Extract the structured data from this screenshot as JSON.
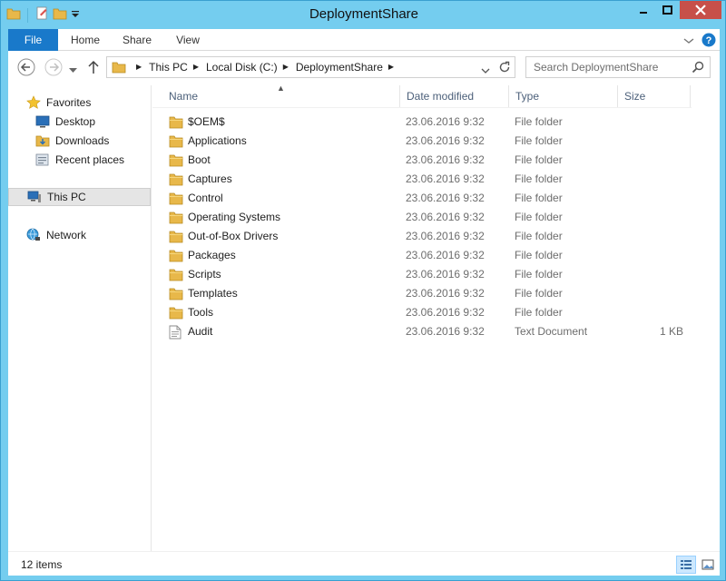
{
  "window": {
    "title": "DeploymentShare"
  },
  "ribbon": {
    "tabs": [
      {
        "label": "File"
      },
      {
        "label": "Home"
      },
      {
        "label": "Share"
      },
      {
        "label": "View"
      }
    ]
  },
  "address": {
    "crumbs": [
      "This PC",
      "Local Disk (C:)",
      "DeploymentShare"
    ]
  },
  "search": {
    "placeholder": "Search DeploymentShare"
  },
  "nav": {
    "favorites": "Favorites",
    "desktop": "Desktop",
    "downloads": "Downloads",
    "recent": "Recent places",
    "thispc": "This PC",
    "network": "Network"
  },
  "columns": {
    "name": "Name",
    "date": "Date modified",
    "type": "Type",
    "size": "Size"
  },
  "files": [
    {
      "name": "$OEM$",
      "date": "23.06.2016 9:32",
      "type": "File folder",
      "size": "",
      "icon": "folder-icon"
    },
    {
      "name": "Applications",
      "date": "23.06.2016 9:32",
      "type": "File folder",
      "size": "",
      "icon": "folder-icon"
    },
    {
      "name": "Boot",
      "date": "23.06.2016 9:32",
      "type": "File folder",
      "size": "",
      "icon": "folder-icon"
    },
    {
      "name": "Captures",
      "date": "23.06.2016 9:32",
      "type": "File folder",
      "size": "",
      "icon": "folder-icon"
    },
    {
      "name": "Control",
      "date": "23.06.2016 9:32",
      "type": "File folder",
      "size": "",
      "icon": "folder-icon"
    },
    {
      "name": "Operating Systems",
      "date": "23.06.2016 9:32",
      "type": "File folder",
      "size": "",
      "icon": "folder-icon"
    },
    {
      "name": "Out-of-Box Drivers",
      "date": "23.06.2016 9:32",
      "type": "File folder",
      "size": "",
      "icon": "folder-icon"
    },
    {
      "name": "Packages",
      "date": "23.06.2016 9:32",
      "type": "File folder",
      "size": "",
      "icon": "folder-icon"
    },
    {
      "name": "Scripts",
      "date": "23.06.2016 9:32",
      "type": "File folder",
      "size": "",
      "icon": "folder-icon"
    },
    {
      "name": "Templates",
      "date": "23.06.2016 9:32",
      "type": "File folder",
      "size": "",
      "icon": "folder-icon"
    },
    {
      "name": "Tools",
      "date": "23.06.2016 9:32",
      "type": "File folder",
      "size": "",
      "icon": "folder-icon"
    },
    {
      "name": "Audit",
      "date": "23.06.2016 9:32",
      "type": "Text Document",
      "size": "1 KB",
      "icon": "text-document-icon"
    }
  ],
  "status": {
    "item_count": "12 items"
  },
  "colors": {
    "frame": "#74cdef",
    "file_tab": "#1979ca",
    "close_button": "#c7504a",
    "folder": "#e8b84a",
    "selected_nav": "#e5e5e5"
  }
}
